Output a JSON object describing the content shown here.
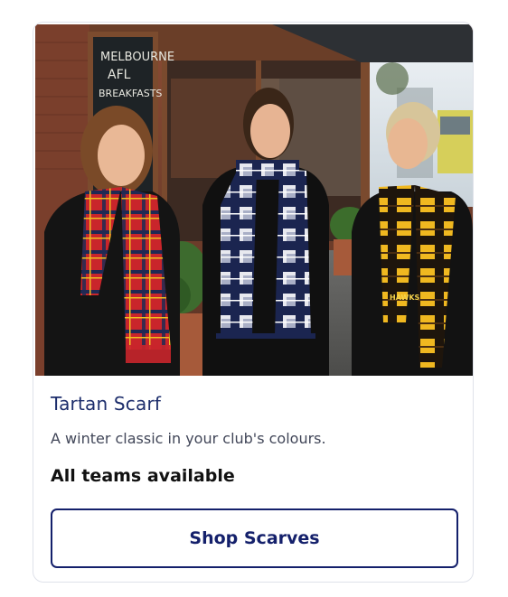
{
  "card": {
    "image": {
      "chalkboard_lines": [
        "MELBOURNE",
        "AFL",
        "BREAKFASTS"
      ],
      "scarf_text": "HAWKS"
    },
    "title": "Tartan Scarf",
    "description": "A winter classic in your club's colours.",
    "availability": "All teams available",
    "button_label": "Shop Scarves"
  },
  "colors": {
    "title": "#1c2d6b",
    "button_border": "#14206b",
    "button_text": "#14206b",
    "availability_text": "#111111"
  }
}
